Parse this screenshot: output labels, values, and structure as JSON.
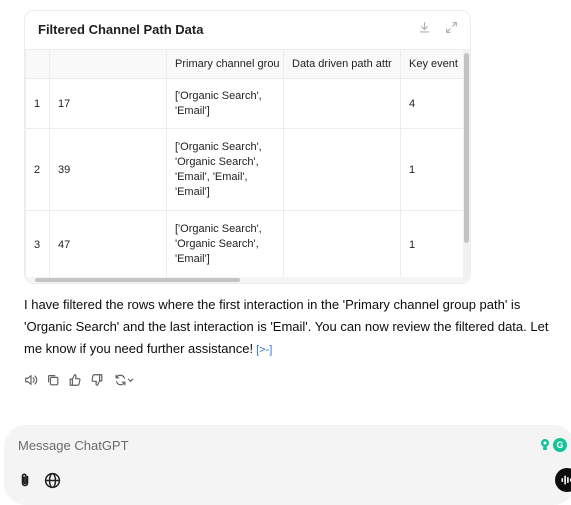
{
  "card": {
    "title": "Filtered Channel Path Data",
    "columns": [
      "",
      "",
      "Primary channel grou",
      "Data driven path attr",
      "Key event"
    ],
    "rows": [
      {
        "idx": "1",
        "col1": "17",
        "path": "['Organic Search', 'Email']",
        "attr": "",
        "key": "4"
      },
      {
        "idx": "2",
        "col1": "39",
        "path": "['Organic Search', 'Organic Search', 'Email', 'Email', 'Email']",
        "attr": "",
        "key": "1"
      },
      {
        "idx": "3",
        "col1": "47",
        "path": "['Organic Search', 'Organic Search', 'Email']",
        "attr": "",
        "key": "1"
      }
    ]
  },
  "message": {
    "text": "I have filtered the rows where the first interaction in the 'Primary channel group path' is 'Organic Search' and the last interaction is 'Email'. You can now review the filtered data. Let me know if you need further assistance!",
    "citation": "[>-]"
  },
  "actions": [
    "read-aloud-icon",
    "copy-icon",
    "thumbs-up-icon",
    "thumbs-down-icon",
    "regenerate-icon"
  ],
  "composer": {
    "placeholder": "Message ChatGPT",
    "grammar_badge": "G"
  }
}
